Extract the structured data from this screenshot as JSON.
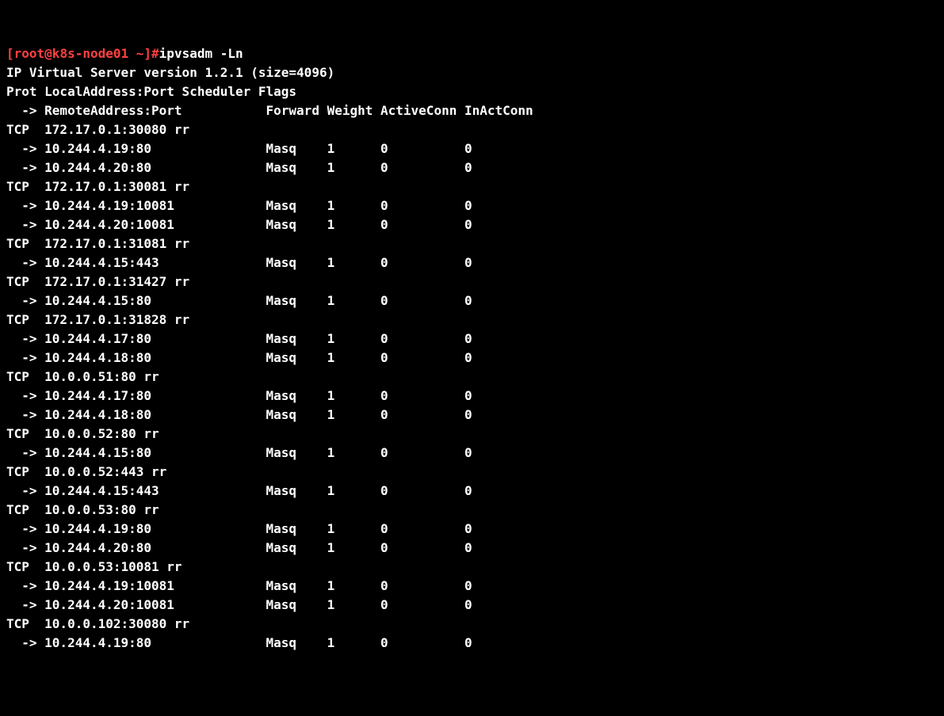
{
  "prompt": {
    "bracket_open": "[",
    "user_host": "root@k8s-node01 ~",
    "bracket_close": "]#",
    "command": "ipvsadm -Ln"
  },
  "header": {
    "version_line": "IP Virtual Server version 1.2.1 (size=4096)",
    "col_line1": "Prot LocalAddress:Port Scheduler Flags",
    "col_line2": "  -> RemoteAddress:Port           Forward Weight ActiveConn InActConn"
  },
  "services": [
    {
      "line": "TCP  172.17.0.1:30080 rr",
      "reals": [
        "  -> 10.244.4.19:80               Masq    1      0          0",
        "  -> 10.244.4.20:80               Masq    1      0          0"
      ]
    },
    {
      "line": "TCP  172.17.0.1:30081 rr",
      "reals": [
        "  -> 10.244.4.19:10081            Masq    1      0          0",
        "  -> 10.244.4.20:10081            Masq    1      0          0"
      ]
    },
    {
      "line": "TCP  172.17.0.1:31081 rr",
      "reals": [
        "  -> 10.244.4.15:443              Masq    1      0          0"
      ]
    },
    {
      "line": "TCP  172.17.0.1:31427 rr",
      "reals": [
        "  -> 10.244.4.15:80               Masq    1      0          0"
      ]
    },
    {
      "line": "TCP  172.17.0.1:31828 rr",
      "reals": [
        "  -> 10.244.4.17:80               Masq    1      0          0",
        "  -> 10.244.4.18:80               Masq    1      0          0"
      ]
    },
    {
      "line": "TCP  10.0.0.51:80 rr",
      "reals": [
        "  -> 10.244.4.17:80               Masq    1      0          0",
        "  -> 10.244.4.18:80               Masq    1      0          0"
      ]
    },
    {
      "line": "TCP  10.0.0.52:80 rr",
      "reals": [
        "  -> 10.244.4.15:80               Masq    1      0          0"
      ]
    },
    {
      "line": "TCP  10.0.0.52:443 rr",
      "reals": [
        "  -> 10.244.4.15:443              Masq    1      0          0"
      ]
    },
    {
      "line": "TCP  10.0.0.53:80 rr",
      "reals": [
        "  -> 10.244.4.19:80               Masq    1      0          0",
        "  -> 10.244.4.20:80               Masq    1      0          0"
      ]
    },
    {
      "line": "TCP  10.0.0.53:10081 rr",
      "reals": [
        "  -> 10.244.4.19:10081            Masq    1      0          0",
        "  -> 10.244.4.20:10081            Masq    1      0          0"
      ]
    },
    {
      "line": "TCP  10.0.0.102:30080 rr",
      "reals": [
        "  -> 10.244.4.19:80               Masq    1      0          0"
      ]
    }
  ]
}
